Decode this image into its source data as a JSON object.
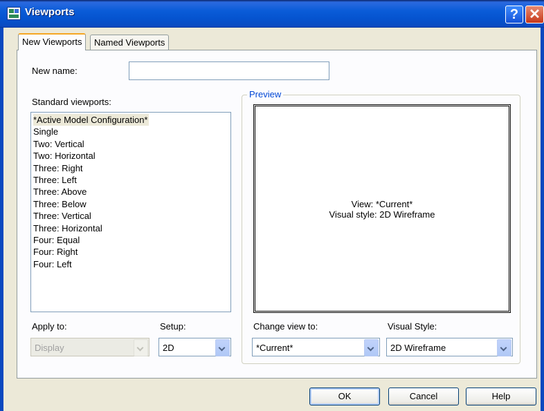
{
  "window": {
    "title": "Viewports",
    "help_glyph": "?",
    "close_glyph": "✕"
  },
  "tabs": [
    {
      "label": "New Viewports"
    },
    {
      "label": "Named Viewports"
    }
  ],
  "new_name": {
    "label": "New name:",
    "value": ""
  },
  "standard_viewports": {
    "label": "Standard viewports:",
    "items": [
      "*Active Model Configuration*",
      "Single",
      "Two:  Vertical",
      "Two:  Horizontal",
      "Three: Right",
      "Three: Left",
      "Three: Above",
      "Three: Below",
      "Three: Vertical",
      "Three: Horizontal",
      "Four: Equal",
      "Four: Right",
      "Four: Left"
    ],
    "selected_index": 0
  },
  "preview": {
    "label": "Preview",
    "view_line": "View: *Current*",
    "style_line": "Visual style: 2D Wireframe"
  },
  "apply_to": {
    "label": "Apply to:",
    "value": "Display",
    "enabled": false
  },
  "setup": {
    "label": "Setup:",
    "value": "2D"
  },
  "change_view_to": {
    "label": "Change view to:",
    "value": "*Current*"
  },
  "visual_style": {
    "label": "Visual Style:",
    "value": "2D Wireframe"
  },
  "buttons": {
    "ok": "OK",
    "cancel": "Cancel",
    "help": "Help"
  },
  "colors": {
    "titlebar": "#0a5cd8",
    "dialog_bg": "#ece9d8",
    "tab_accent": "#f5a623",
    "group_label": "#0046d5"
  }
}
